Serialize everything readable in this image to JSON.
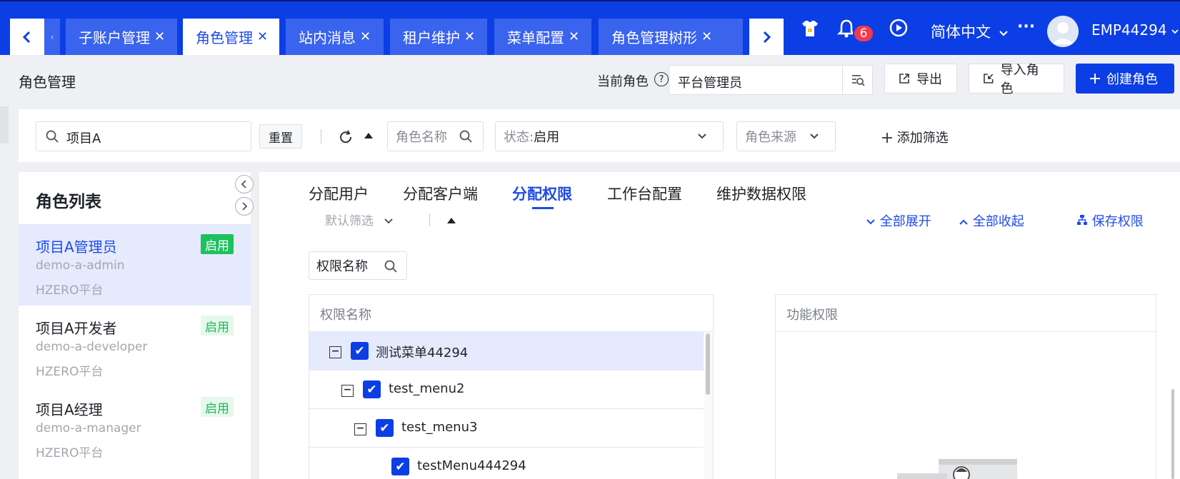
{
  "tabs": [
    {
      "label": "子账户管理",
      "close": "✕"
    },
    {
      "label": "角色管理",
      "close": "✕"
    },
    {
      "label": "站内消息",
      "close": "✕"
    },
    {
      "label": "租户维护",
      "close": "✕"
    },
    {
      "label": "菜单配置",
      "close": "✕"
    },
    {
      "label": "角色管理树形",
      "close": "✕"
    }
  ],
  "header": {
    "notification_count": "6",
    "language": "简体中文",
    "more": "···",
    "username": "EMP44294",
    "icons": [
      "tshirt-icon",
      "bell-icon",
      "play-icon",
      "more-icon"
    ]
  },
  "page": {
    "title": "角色管理",
    "current_role_label": "当前角色",
    "help": "?",
    "current_role_value": "平台管理员",
    "export": "导出",
    "import": "导入角色",
    "create": "创建角色"
  },
  "filters": {
    "search_value": "项目A",
    "reset": "重置",
    "role_name_placeholder": "角色名称",
    "status_label": "状态:",
    "status_value": "启用",
    "source_placeholder": "角色来源",
    "add_filter": "添加筛选"
  },
  "role_list": {
    "title": "角色列表",
    "items": [
      {
        "name": "项目A管理员",
        "code": "demo-a-admin",
        "source": "HZERO平台",
        "status": "启用"
      },
      {
        "name": "项目A开发者",
        "code": "demo-a-developer",
        "source": "HZERO平台",
        "status": "启用"
      },
      {
        "name": "项目A经理",
        "code": "demo-a-manager",
        "source": "HZERO平台",
        "status": "启用"
      }
    ]
  },
  "main": {
    "tabs": [
      "分配用户",
      "分配客户端",
      "分配权限",
      "工作台配置",
      "维护数据权限"
    ],
    "active_tab": "分配权限",
    "default_filter": "默认筛选",
    "expand_all": "全部展开",
    "collapse_all": "全部收起",
    "save": "保存权限",
    "perm_search_placeholder": "权限名称",
    "tree_header": "权限名称",
    "tree": [
      {
        "label": "测试菜单44294",
        "checked": true,
        "expanded": true
      },
      {
        "label": "test_menu2",
        "checked": true,
        "expanded": true
      },
      {
        "label": "test_menu3",
        "checked": true,
        "expanded": true
      },
      {
        "label": "testMenu444294",
        "checked": true,
        "expanded": false
      }
    ],
    "func_header": "功能权限"
  },
  "colors": {
    "primary": "#0c3ee6",
    "success": "#1dc15e",
    "selected_bg": "#e5ebfd"
  }
}
